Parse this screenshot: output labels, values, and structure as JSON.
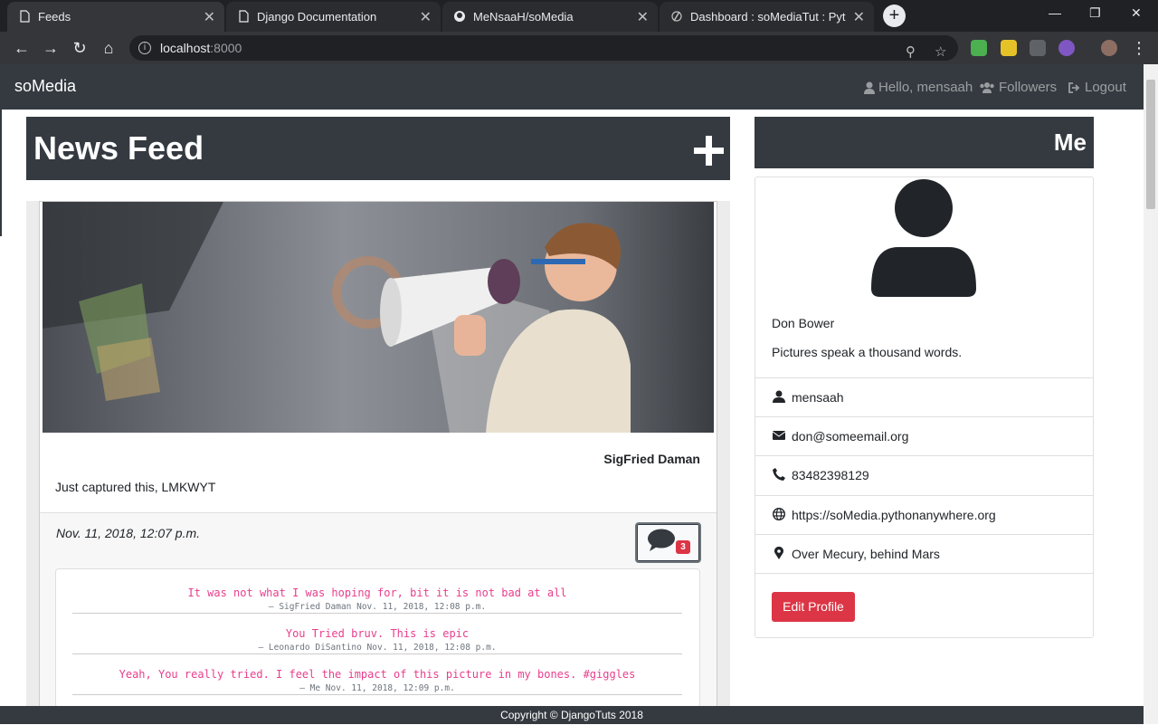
{
  "browser": {
    "tabs": [
      {
        "title": "Feeds",
        "active": true
      },
      {
        "title": "Django Documentation",
        "active": false
      },
      {
        "title": "MeNsaaH/soMedia",
        "active": false
      },
      {
        "title": "Dashboard : soMediaTut : Python",
        "active": false
      }
    ],
    "url_host": "localhost",
    "url_port": ":8000"
  },
  "nav": {
    "brand": "soMedia",
    "greeting": "Hello, mensaah",
    "followers": "Followers",
    "logout": "Logout"
  },
  "feed": {
    "title": "News Feed",
    "post": {
      "author": "SigFried Daman",
      "caption": "Just captured this, LMKWYT",
      "date": "Nov. 11, 2018, 12:07 p.m.",
      "comment_count": "3",
      "comments": [
        {
          "text": "It was not what I was hoping for, bit it is not bad at all",
          "meta": "–  SigFried Daman Nov. 11, 2018, 12:08 p.m."
        },
        {
          "text": "You Tried bruv. This is epic",
          "meta": "–  Leonardo DiSantino Nov. 11, 2018, 12:08 p.m."
        },
        {
          "text": "Yeah, You really tried. I feel the impact of this picture in my bones. #giggles",
          "meta": "–  Me Nov. 11, 2018, 12:09 p.m."
        }
      ]
    }
  },
  "profile": {
    "title": "Me",
    "name": "Don Bower",
    "bio": "Pictures speak a thousand words.",
    "username": "mensaah",
    "email": "don@someemail.org",
    "phone": "83482398129",
    "website": "https://soMedia.pythonanywhere.org",
    "location": "Over Mecury, behind Mars",
    "edit_label": "Edit Profile"
  },
  "footer": {
    "text": "Copyright © DjangoTuts 2018"
  },
  "colors": {
    "dark": "#343a40",
    "danger": "#dc3545",
    "comment_pink": "#e83e8c"
  }
}
